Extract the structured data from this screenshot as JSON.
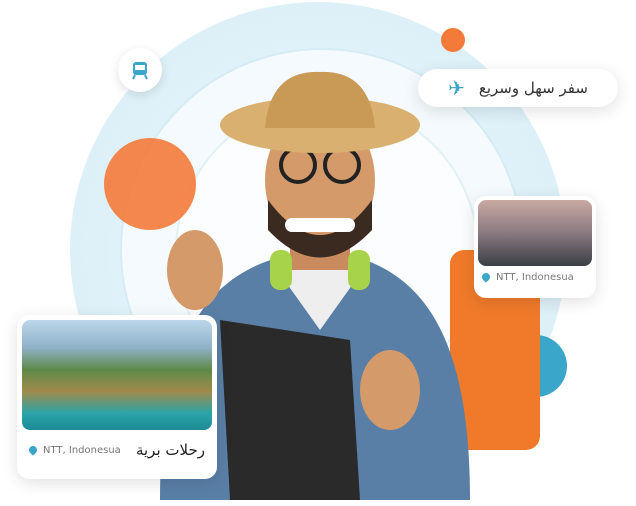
{
  "badge_fast_travel": {
    "label": "سفر سهل وسريع",
    "icon": "airplane-icon"
  },
  "train_badge": {
    "icon": "train-icon"
  },
  "card_top": {
    "location": "NTT, Indonesua"
  },
  "card_bottom": {
    "title": "رحلات برية",
    "location": "NTT, Indonesua"
  },
  "colors": {
    "accent_blue": "#3aa6c9",
    "accent_orange": "#f47a3a",
    "ring": "#d9eff7"
  }
}
